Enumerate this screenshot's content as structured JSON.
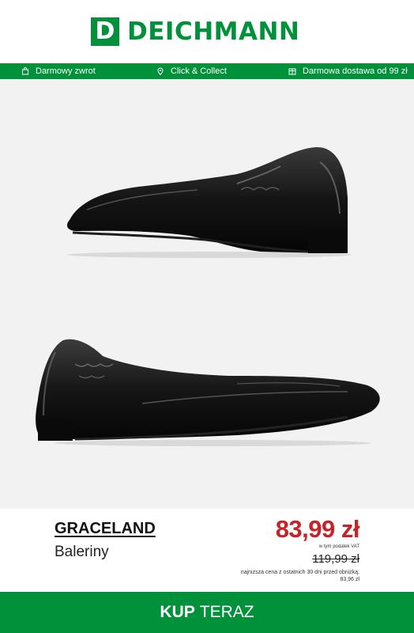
{
  "brand": {
    "logo_letter": "D",
    "name": "DEICHMANN",
    "color": "#00913a"
  },
  "benefits": [
    {
      "icon": "return-bag-icon",
      "label": "Darmowy zwrot"
    },
    {
      "icon": "location-pin-icon",
      "label": "Click & Collect"
    },
    {
      "icon": "delivery-box-icon",
      "label": "Darmowa dostawa od 99 zł"
    }
  ],
  "product": {
    "brand": "GRACELAND",
    "category": "Baleriny",
    "price": "83,99 zł",
    "vat_note": "w tym podatek VAT",
    "old_price": "119,99 zł",
    "lowest_price_note": "najniższa cena z ostatnich 30 dni przed obniżką:",
    "lowest_price": "83,96 zł",
    "price_color": "#c72228"
  },
  "cta": {
    "label_strong": "KUP",
    "label_light": "TERAZ"
  }
}
